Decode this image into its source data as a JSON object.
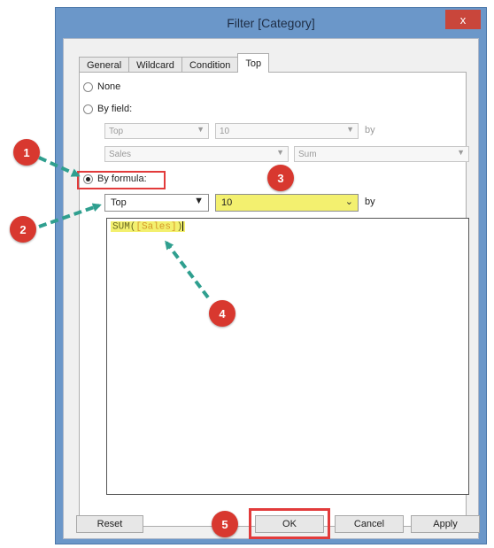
{
  "window": {
    "title": "Filter [Category]",
    "close_glyph": "x"
  },
  "tabs": [
    {
      "label": "General",
      "active": false
    },
    {
      "label": "Wildcard",
      "active": false
    },
    {
      "label": "Condition",
      "active": false
    },
    {
      "label": "Top",
      "active": true
    }
  ],
  "options": {
    "none_label": "None",
    "by_field_label": "By field:",
    "by_formula_label": "By formula:",
    "selected": "By formula:"
  },
  "by_field": {
    "direction": "Top",
    "count": "10",
    "by_label": "by",
    "field": "Sales",
    "aggregation": "Sum"
  },
  "by_formula": {
    "direction": "Top",
    "count": "10",
    "by_label": "by",
    "formula_func": "SUM(",
    "formula_field": "[Sales]",
    "formula_close": ")"
  },
  "buttons": {
    "reset": "Reset",
    "ok": "OK",
    "cancel": "Cancel",
    "apply": "Apply"
  },
  "markers": [
    "1",
    "2",
    "3",
    "4",
    "5"
  ],
  "colors": {
    "highlight_red": "#e23b3b",
    "marker_red": "#d8382f",
    "arrow_teal": "#2f9f8f",
    "value_yellow": "#f3f06f",
    "titlebar_blue": "#6b97c9"
  }
}
